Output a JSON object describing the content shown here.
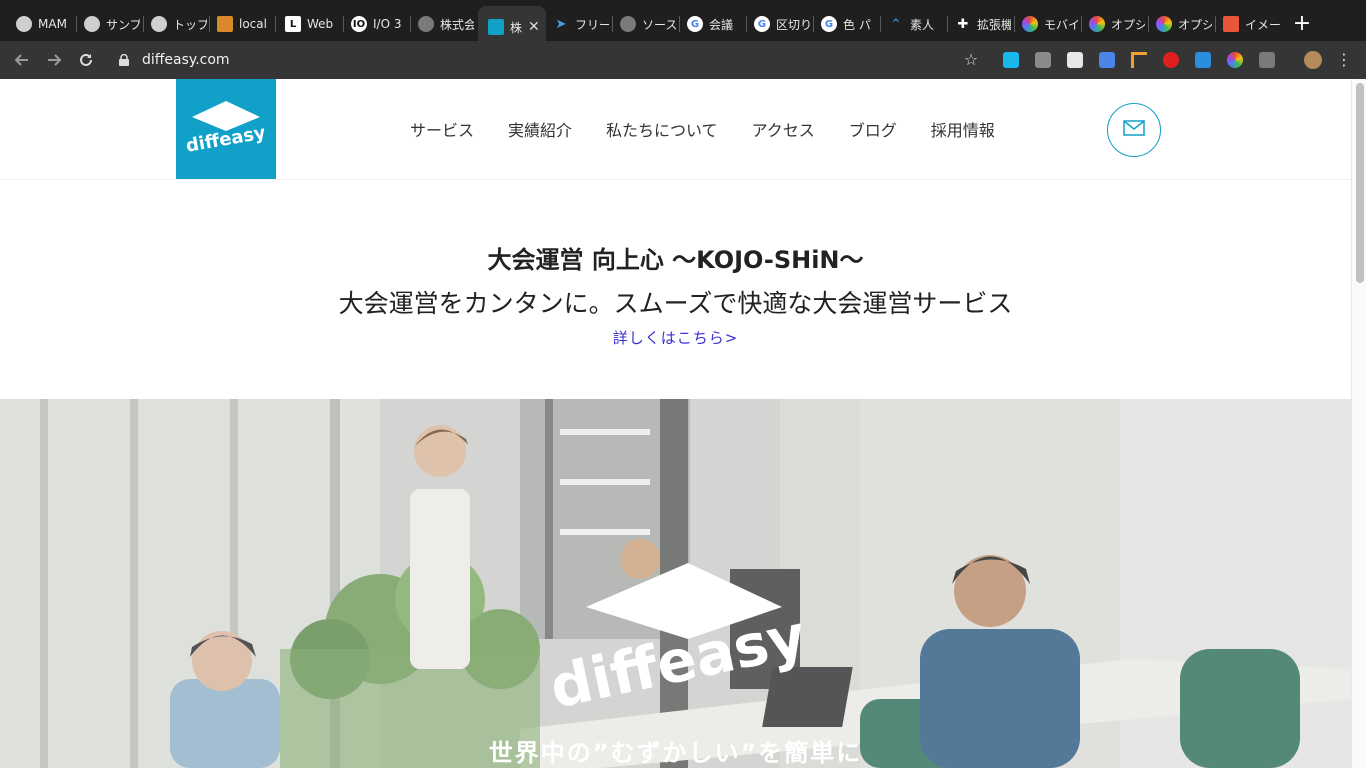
{
  "browser": {
    "tabs": [
      {
        "label": "MAM",
        "favicon": "ghost-icon",
        "color": "#cfcfcf"
      },
      {
        "label": "サンプ",
        "favicon": "ghost-icon",
        "color": "#cfcfcf"
      },
      {
        "label": "トップ",
        "favicon": "ghost-icon",
        "color": "#cfcfcf"
      },
      {
        "label": "local",
        "favicon": "lines-icon",
        "color": "#d98a2a"
      },
      {
        "label": "Web",
        "favicon": "l-icon",
        "color": "#ffffff"
      },
      {
        "label": "I/O 3",
        "favicon": "io-icon",
        "color": "#ffffff"
      },
      {
        "label": "株式会",
        "favicon": "globe-icon",
        "color": "#9a9a9a"
      },
      {
        "label": "株",
        "favicon": "diffeasy-icon",
        "color": "#11a0c8",
        "active": true
      },
      {
        "label": "フリー",
        "favicon": "paper-plane-icon",
        "color": "#4a9fd8"
      },
      {
        "label": "ソース",
        "favicon": "globe-icon",
        "color": "#9a9a9a"
      },
      {
        "label": "会議",
        "favicon": "google-icon",
        "color": "#ffffff"
      },
      {
        "label": "区切り",
        "favicon": "google-icon",
        "color": "#ffffff"
      },
      {
        "label": "色 パ",
        "favicon": "google-icon",
        "color": "#ffffff"
      },
      {
        "label": "素人",
        "favicon": "chevrons-up-icon",
        "color": "#2f8de4"
      },
      {
        "label": "拡張機",
        "favicon": "puzzle-icon",
        "color": "#ffffff"
      },
      {
        "label": "モバイ",
        "favicon": "color-wheel-icon",
        "color": "#e94b8a"
      },
      {
        "label": "オプシ",
        "favicon": "color-wheel-icon",
        "color": "#e94b8a"
      },
      {
        "label": "オプシ",
        "favicon": "color-wheel-icon",
        "color": "#e94b8a"
      },
      {
        "label": "イメー",
        "favicon": "image-icon",
        "color": "#e9553a"
      }
    ],
    "close_glyph": "✕",
    "new_tab_glyph": "+",
    "url": "diffeasy.com"
  },
  "site": {
    "logo_text": "diffeasy",
    "brand_color": "#11a0c8",
    "nav": [
      "サービス",
      "実績紹介",
      "私たちについて",
      "アクセス",
      "ブログ",
      "採用情報"
    ]
  },
  "announcement": {
    "title": "大会運営 向上心 〜KOJO-SHiN〜",
    "subtitle": "大会運営をカンタンに。スムーズで快適な大会運営サービス",
    "link": "詳しくはこちら>"
  },
  "hero": {
    "logo_text": "diffeasy",
    "tagline": "世界中の”むずかしい”を簡単に"
  }
}
